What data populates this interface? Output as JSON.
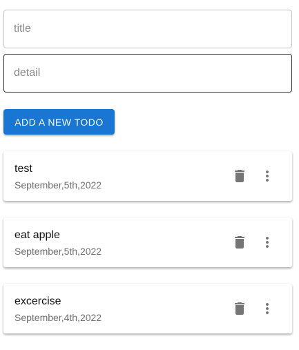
{
  "form": {
    "title_placeholder": "title",
    "detail_placeholder": "detail",
    "title_value": "",
    "detail_value": "",
    "add_button_label": "ADD A NEW TODO"
  },
  "todos": [
    {
      "title": "test",
      "date": "September,5th,2022"
    },
    {
      "title": "eat apple",
      "date": "September,5th,2022"
    },
    {
      "title": "excercise",
      "date": "September,4th,2022"
    }
  ],
  "colors": {
    "primary": "#1976d2",
    "icon": "#757575"
  },
  "icons": {
    "delete": "trash-icon",
    "more": "more-vertical-icon"
  }
}
